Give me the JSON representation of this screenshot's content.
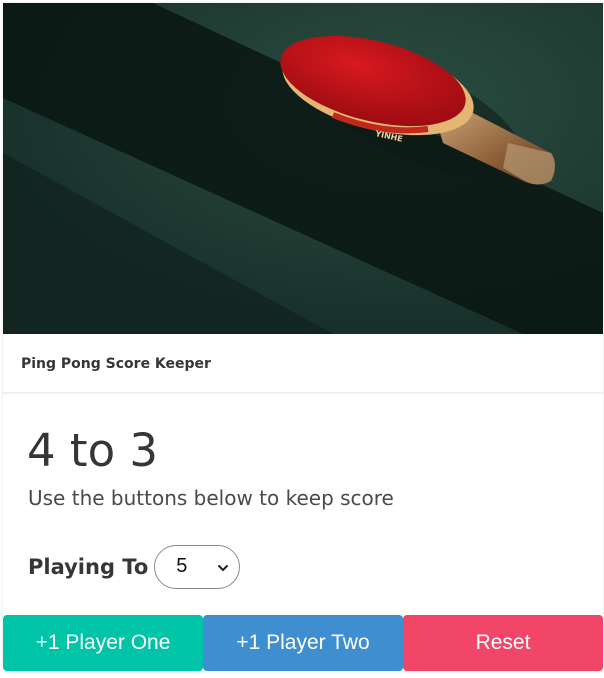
{
  "header": {
    "title": "Ping Pong Score Keeper"
  },
  "score": {
    "text": "4 to 3",
    "player_one": 4,
    "player_two": 3
  },
  "instructions": "Use the buttons below to keep score",
  "playing_to": {
    "label": "Playing To",
    "selected": "5"
  },
  "buttons": {
    "player_one": "+1 Player One",
    "player_two": "+1 Player Two",
    "reset": "Reset"
  },
  "paddle_brand_text": "YINHE",
  "colors": {
    "player_one_button": "#00c4a7",
    "player_two_button": "#3e8ed0",
    "reset_button": "#f14668",
    "table_surface": "#1f3a30",
    "paddle_rubber": "#c8131a"
  },
  "icons": {
    "select_arrow": "chevron-down-icon"
  }
}
